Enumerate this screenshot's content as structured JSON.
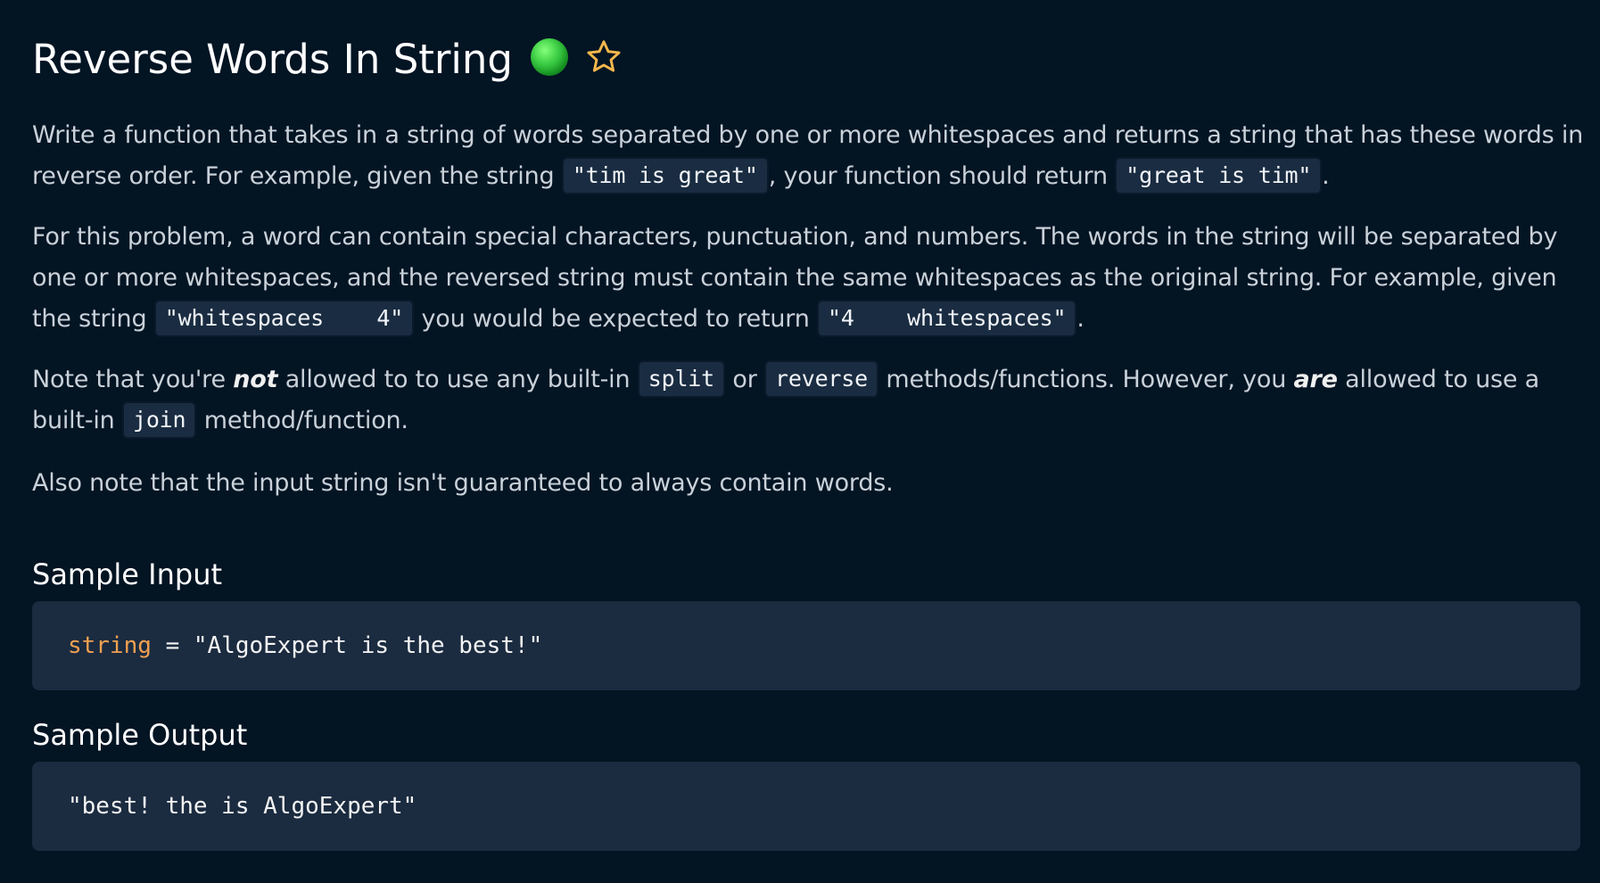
{
  "problem": {
    "title": "Reverse Words In String",
    "status_color": "#2ecc40",
    "status_icon": "green-circle-icon",
    "favorite_icon": "star-outline-icon",
    "favorite_color": "#f5b84b"
  },
  "description": {
    "p1": {
      "t1": "Write a function that takes in a string of words separated by one or more whitespaces and returns a string that has these words in reverse order. For example, given the string ",
      "c1": "\"tim is great\"",
      "t2": ", your function should return ",
      "c2": "\"great is tim\"",
      "t3": "."
    },
    "p2": {
      "t1": "For this problem, a word can contain special characters, punctuation, and numbers. The words in the string will be separated by one or more whitespaces, and the reversed string must contain the same whitespaces as the original string. For example, given the string ",
      "c1": "\"whitespaces    4\"",
      "t2": " you would be expected to return ",
      "c2": "\"4    whitespaces\"",
      "t3": "."
    },
    "p3": {
      "t1": "Note that you're ",
      "e1": "not",
      "t2": " allowed to to use any built-in ",
      "c1": "split",
      "t3": " or ",
      "c2": "reverse",
      "t4": " methods/functions. However, you ",
      "e2": "are",
      "t5": " allowed to use a built-in ",
      "c3": "join",
      "t6": " method/function."
    },
    "p4": "Also note that the input string isn't guaranteed to always contain words."
  },
  "sample_input": {
    "heading": "Sample Input",
    "variable": "string",
    "operator": " = ",
    "value": "\"AlgoExpert is the best!\""
  },
  "sample_output": {
    "heading": "Sample Output",
    "value": "\"best! the is AlgoExpert\""
  }
}
